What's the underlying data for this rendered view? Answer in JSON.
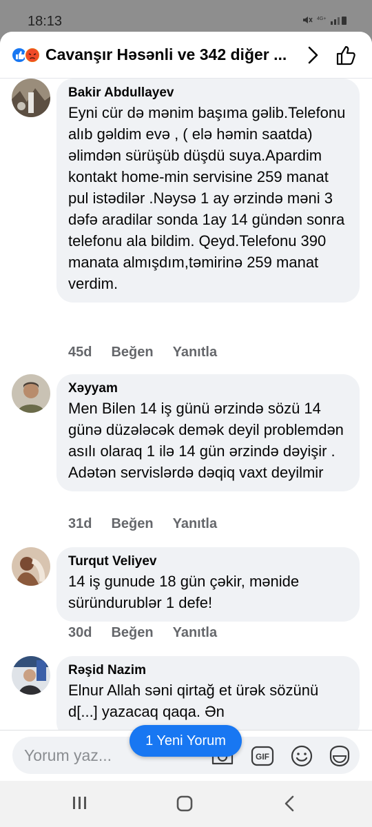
{
  "status": {
    "time": "18:13"
  },
  "header": {
    "title": "Cavanşır Həsənli ve 342 diğer ..."
  },
  "comments": [
    {
      "author": "Bakir Abdullayev",
      "text": "Eyni cür də mənim başıma gəlib.Telefonu alıb gəldim evə , ( elə həmin saatda) əlimdən sürüşüb düşdü suya.Apardim kontakt home-min servisine 259 manat pul istədilər .Nəysə 1 ay ərzində məni 3 dəfə aradilar sonda 1ay 14 gündən sonra telefonu ala bildim. Qeyd.Telefonu 390 manata almışdım,təmirinə 259 manat verdim.",
      "time": "45d",
      "like": "Beğen",
      "reply": "Yanıtla"
    },
    {
      "author": "Xəyyam",
      "text": "Men Bilen 14 iş günü ərzində sözü 14 günə düzələcək demək deyil problemdən asılı olaraq 1 ilə 14 gün ərzində dəyişir . Adətən servislərdə dəqiq vaxt deyilmir",
      "time": "31d",
      "like": "Beğen",
      "reply": "Yanıtla"
    },
    {
      "author": "Turqut Veliyev",
      "text": "14 iş gunude 18 gün çəkir, mənide süründurublər 1 defe!",
      "time": "30d",
      "like": "Beğen",
      "reply": "Yanıtla"
    },
    {
      "author": "Rəşid Nazim",
      "text": "Elnur Allah səni qirtağ et ürək sözünü d[...] yazacaq qaqa. Ən"
    }
  ],
  "new_comments_pill": "1 Yeni Yorum",
  "composer": {
    "placeholder": "Yorum yaz..."
  },
  "icons": [
    "like-reaction-icon",
    "angry-reaction-icon",
    "chevron-right-icon",
    "thumbs-up-icon",
    "camera-icon",
    "gif-icon",
    "emoji-icon",
    "sticker-icon",
    "recent-apps-icon",
    "home-icon",
    "back-icon"
  ],
  "colors": {
    "accent": "#1877f2",
    "bubble": "#f0f2f5",
    "meta": "#65676b"
  }
}
